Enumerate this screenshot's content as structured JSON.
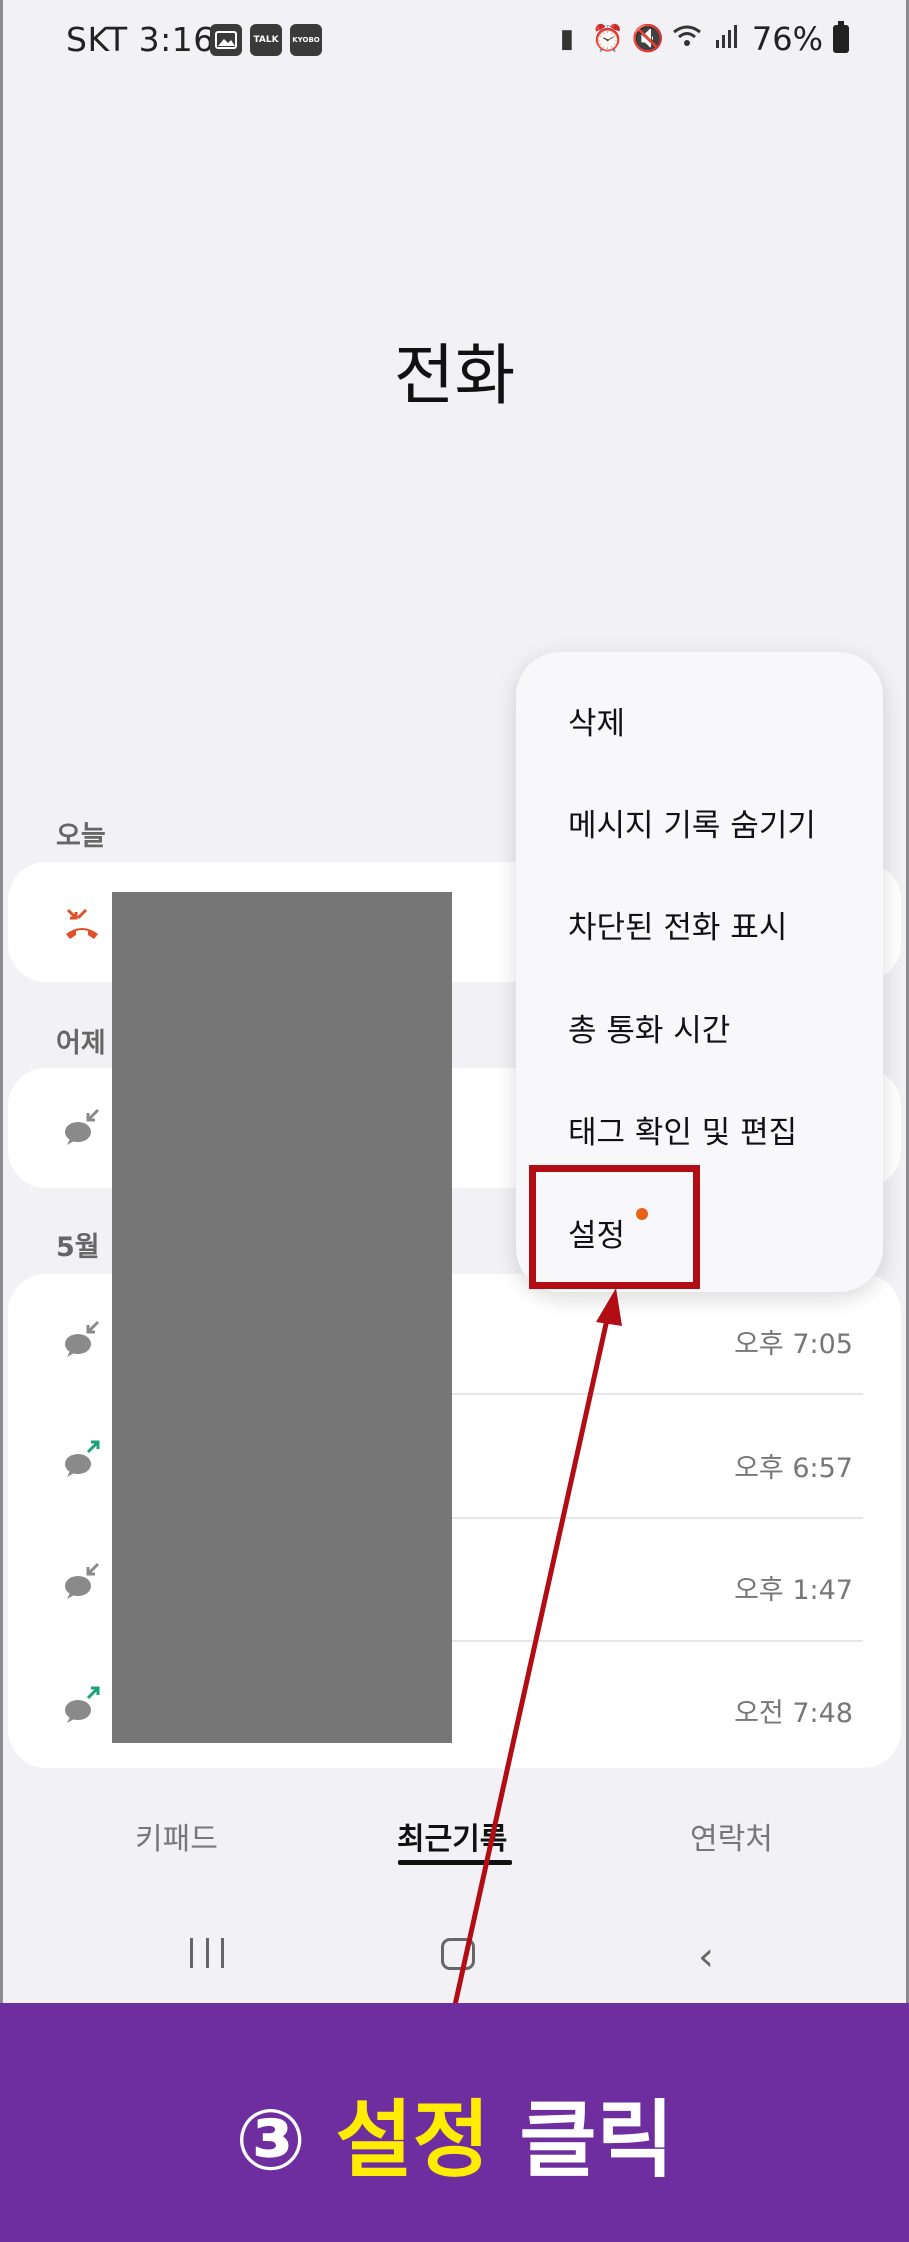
{
  "status_bar": {
    "carrier_time": "SKT 3:16",
    "left_icons": [
      "gallery-icon",
      "kakaotalk-icon",
      "kyobo-icon"
    ],
    "talk_label": "TALK",
    "kyobo_label": "KYOBO",
    "right_icons": [
      "battery-saver-icon",
      "alarm-icon",
      "mute-icon",
      "wifi-icon",
      "signal-icon"
    ],
    "battery": "76%"
  },
  "app": {
    "title": "전화"
  },
  "sections": {
    "today": "오늘",
    "yesterday": "어제",
    "may": "5월"
  },
  "calls": [
    {
      "icon": "missed-call-icon",
      "time": ""
    },
    {
      "icon": "incoming-message-icon",
      "time": ""
    },
    {
      "icon": "incoming-message-icon",
      "time": "오후 7:05"
    },
    {
      "icon": "outgoing-message-icon",
      "time": "오후 6:57"
    },
    {
      "icon": "incoming-message-icon",
      "time": "오후 1:47"
    },
    {
      "icon": "outgoing-message-icon",
      "time": "오전 7:48"
    }
  ],
  "menu": {
    "items": [
      "삭제",
      "메시지 기록 숨기기",
      "차단된 전화 표시",
      "총 통화 시간",
      "태그 확인 및 편집",
      "설정"
    ]
  },
  "tabs": {
    "keypad": "키패드",
    "recents": "최근기록",
    "contacts": "연락처"
  },
  "banner": {
    "step": "③",
    "highlight": "설정",
    "action": "클릭"
  },
  "colors": {
    "accent_red": "#b20d14",
    "banner_bg": "#6e2ea0",
    "highlight_yellow": "#ffec00",
    "badge_dot": "#e8621c",
    "missed_call": "#e0502a",
    "outgoing_arrow": "#1aa37a"
  }
}
